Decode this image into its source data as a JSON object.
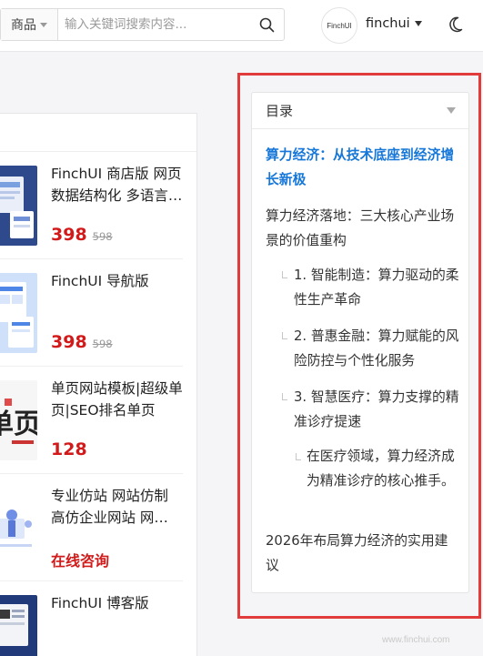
{
  "header": {
    "search_category": "商品",
    "search_placeholder": "输入关键词搜索内容...",
    "avatar_text": "FinchUI",
    "username": "finchui"
  },
  "products": [
    {
      "title": "FinchUI 商店版 网页数据结构化 多语言…",
      "price": "398",
      "old_price": "598"
    },
    {
      "title": "FinchUI 导航版",
      "price": "398",
      "old_price": "598"
    },
    {
      "title": "单页网站模板|超级单页|SEO排名单页",
      "price": "128"
    },
    {
      "title": "专业仿站 网站仿制 高仿企业网站 网…",
      "consult": "在线咨询"
    },
    {
      "title": "FinchUI 博客版"
    }
  ],
  "toc": {
    "title": "目录",
    "items": [
      {
        "label": "算力经济：从技术底座到经济增长新极"
      },
      {
        "label": "算力经济落地：三大核心产业场景的价值重构"
      },
      {
        "label": "1. 智能制造：算力驱动的柔性生产革命"
      },
      {
        "label": "2. 普惠金融：算力赋能的风险防控与个性化服务"
      },
      {
        "label": "3. 智慧医疗：算力支撑的精准诊疗提速"
      },
      {
        "label": "在医疗领域，算力经济成为精准诊疗的核心推手。"
      },
      {
        "label": "2026年布局算力经济的实用建议"
      }
    ]
  },
  "watermark": "www.finchui.com",
  "colors": {
    "accent": "#1677d9",
    "price": "#d21a1a",
    "highlight_border": "#e23b3b"
  }
}
